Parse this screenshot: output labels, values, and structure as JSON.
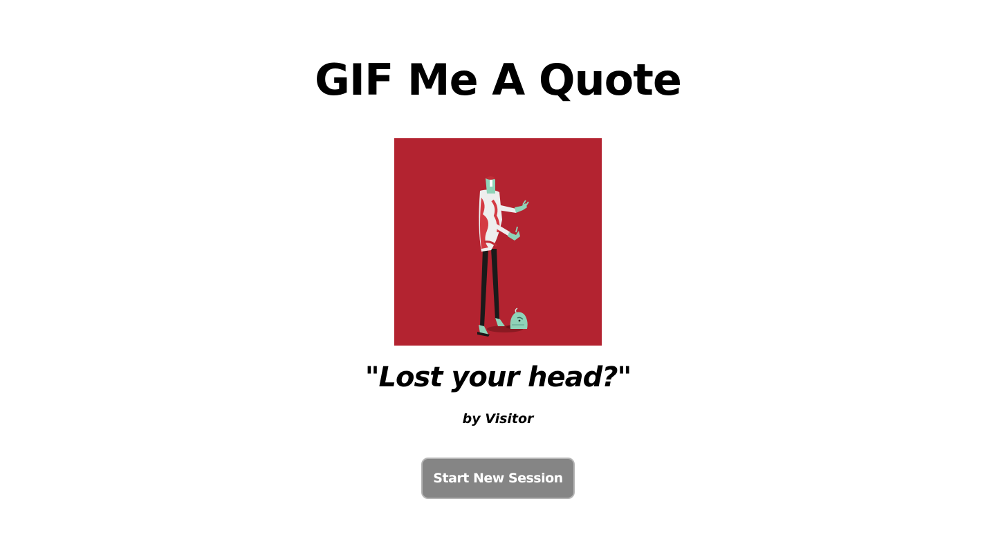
{
  "header": {
    "title": "GIF Me A Quote"
  },
  "gif": {
    "description_icon": "zombie-losing-head-illustration",
    "background_color": "#b32330"
  },
  "quote": {
    "text": "\"Lost your head?\"",
    "author": "by Visitor"
  },
  "actions": {
    "start_new_session_label": "Start New Session",
    "button_color": "#858585"
  }
}
